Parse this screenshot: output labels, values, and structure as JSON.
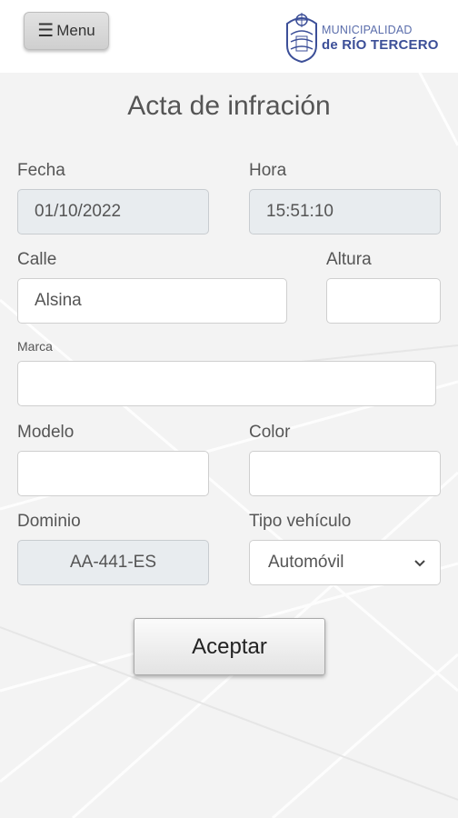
{
  "header": {
    "menu_icon": "hamburger-icon",
    "menu_label": "Menu",
    "logo_line1": "MUNICIPALIDAD",
    "logo_line2": "de RÍO TERCERO"
  },
  "form": {
    "title": "Acta de infración",
    "fecha": {
      "label": "Fecha",
      "value": "01/10/2022"
    },
    "hora": {
      "label": "Hora",
      "value": "15:51:10"
    },
    "calle": {
      "label": "Calle",
      "value": "Alsina"
    },
    "altura": {
      "label": "Altura",
      "value": ""
    },
    "marca": {
      "label": "Marca",
      "value": ""
    },
    "modelo": {
      "label": "Modelo",
      "value": ""
    },
    "color": {
      "label": "Color",
      "value": ""
    },
    "dominio": {
      "label": "Dominio",
      "value": "AA-441-ES"
    },
    "tipo_vehiculo": {
      "label": "Tipo vehículo",
      "selected": "Automóvil"
    },
    "accept_label": "Aceptar"
  },
  "colors": {
    "logo_blue": "#3c4f98",
    "readonly_bg": "#e8ecef"
  }
}
